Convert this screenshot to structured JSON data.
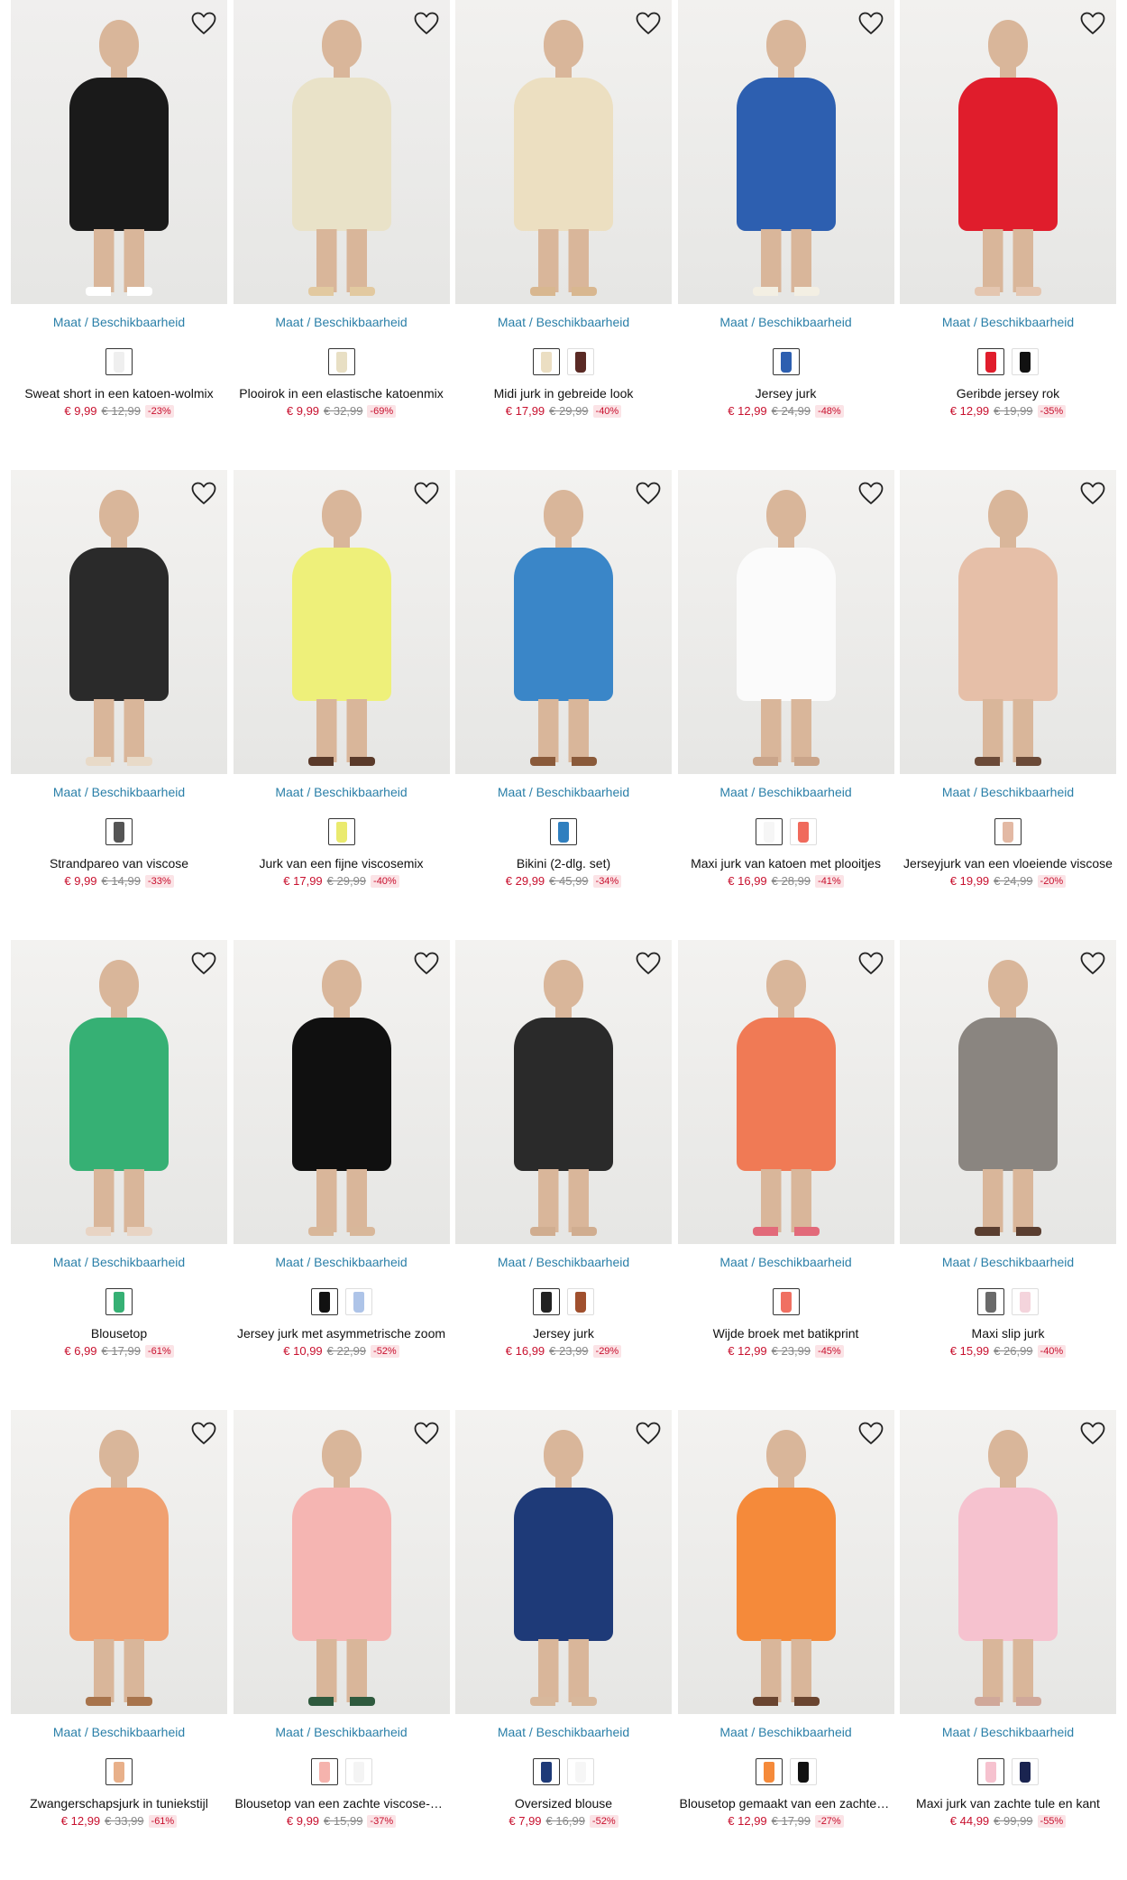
{
  "availability_label": "Maat / Beschikbaarheid",
  "products": [
    {
      "name": "Sweat short in een katoen-wolmix",
      "price": "€ 9,99",
      "old_price": "€ 12,99",
      "discount": "-23%",
      "image_colors": [
        "#f0efee",
        "#1a1a1a",
        "#ffffff"
      ],
      "swatches": [
        "#efefef"
      ]
    },
    {
      "name": "Plooirok in een elastische katoenmix",
      "price": "€ 9,99",
      "old_price": "€ 32,99",
      "discount": "-69%",
      "image_colors": [
        "#f0efee",
        "#e9e2c8",
        "#e2c9a0"
      ],
      "swatches": [
        "#e8dfc4"
      ]
    },
    {
      "name": "Midi jurk in gebreide look",
      "price": "€ 17,99",
      "old_price": "€ 29,99",
      "discount": "-40%",
      "image_colors": [
        "#f2f1ef",
        "#ecdfc1",
        "#d8b790"
      ],
      "swatches": [
        "#ebdec2",
        "#5a2a25"
      ]
    },
    {
      "name": "Jersey jurk",
      "price": "€ 12,99",
      "old_price": "€ 24,99",
      "discount": "-48%",
      "image_colors": [
        "#f2f1ef",
        "#2d5fb0",
        "#f3efe3"
      ],
      "swatches": [
        "#2d5fb0"
      ]
    },
    {
      "name": "Geribde jersey rok",
      "price": "€ 12,99",
      "old_price": "€ 19,99",
      "discount": "-35%",
      "image_colors": [
        "#f2f1ef",
        "#e01d2c",
        "#e4c6b0"
      ],
      "swatches": [
        "#e01d2c",
        "#111111"
      ]
    },
    {
      "name": "Strandpareo van viscose",
      "price": "€ 9,99",
      "old_price": "€ 14,99",
      "discount": "-33%",
      "image_colors": [
        "#f3f2f0",
        "#2a2a2a",
        "#e8dac8"
      ],
      "swatches": [
        "#555555"
      ]
    },
    {
      "name": "Jurk van een fijne viscosemix",
      "price": "€ 17,99",
      "old_price": "€ 29,99",
      "discount": "-40%",
      "image_colors": [
        "#f3f2f0",
        "#eef07a",
        "#5a3a2a"
      ],
      "swatches": [
        "#eaea6e"
      ]
    },
    {
      "name": "Bikini (2-dlg. set)",
      "price": "€ 29,99",
      "old_price": "€ 45,99",
      "discount": "-34%",
      "image_colors": [
        "#f3f2f0",
        "#3a86c8",
        "#8a5a3a"
      ],
      "swatches": [
        "#2f7fbf"
      ]
    },
    {
      "name": "Maxi jurk van katoen met plooitjes",
      "price": "€ 16,99",
      "old_price": "€ 28,99",
      "discount": "-41%",
      "image_colors": [
        "#f3f2f0",
        "#fbfbfb",
        "#caa58a"
      ],
      "swatches": [
        "#f6f6f6",
        "#f06a5c"
      ]
    },
    {
      "name": "Jerseyjurk van een vloeiende viscose",
      "price": "€ 19,99",
      "old_price": "€ 24,99",
      "discount": "-20%",
      "image_colors": [
        "#f3f2f0",
        "#e6bfa8",
        "#6b4a38"
      ],
      "swatches": [
        "#e3b9a4"
      ]
    },
    {
      "name": "Blousetop",
      "price": "€ 6,99",
      "old_price": "€ 17,99",
      "discount": "-61%",
      "image_colors": [
        "#f3f2f0",
        "#36b074",
        "#e8d4c4"
      ],
      "swatches": [
        "#36b074"
      ]
    },
    {
      "name": "Jersey jurk met asymmetrische zoom",
      "price": "€ 10,99",
      "old_price": "€ 22,99",
      "discount": "-52%",
      "image_colors": [
        "#f3f2f0",
        "#101010",
        "#d8b79a"
      ],
      "swatches": [
        "#111111",
        "#aec4e8"
      ]
    },
    {
      "name": "Jersey jurk",
      "price": "€ 16,99",
      "old_price": "€ 23,99",
      "discount": "-29%",
      "image_colors": [
        "#f3f2f0",
        "#2a2a2a",
        "#d0ad90"
      ],
      "swatches": [
        "#222222",
        "#a0502e"
      ]
    },
    {
      "name": "Wijde broek met batikprint",
      "price": "€ 12,99",
      "old_price": "€ 23,99",
      "discount": "-45%",
      "image_colors": [
        "#f3f2f0",
        "#f07a55",
        "#e26a7a"
      ],
      "swatches": [
        "#f07062"
      ]
    },
    {
      "name": "Maxi slip jurk",
      "price": "€ 15,99",
      "old_price": "€ 26,99",
      "discount": "-40%",
      "image_colors": [
        "#f3f2f0",
        "#8a8580",
        "#5a3e30"
      ],
      "swatches": [
        "#6a6a6a",
        "#f4d4dc"
      ]
    },
    {
      "name": "Zwangerschapsjurk in tuniekstijl",
      "price": "€ 12,99",
      "old_price": "€ 33,99",
      "discount": "-61%",
      "image_colors": [
        "#f3f2f0",
        "#f0a070",
        "#a8744c"
      ],
      "swatches": [
        "#e8b08a"
      ]
    },
    {
      "name": "Blousetop van een zachte viscose-mix",
      "price": "€ 9,99",
      "old_price": "€ 15,99",
      "discount": "-37%",
      "image_colors": [
        "#f3f2f0",
        "#f5b5b2",
        "#2f5a3e"
      ],
      "swatches": [
        "#f5b3ad",
        "#f4f4f4"
      ]
    },
    {
      "name": "Oversized blouse",
      "price": "€ 7,99",
      "old_price": "€ 16,99",
      "discount": "-52%",
      "image_colors": [
        "#f3f2f0",
        "#1e3a78",
        "#d8b89c"
      ],
      "swatches": [
        "#1e3a78",
        "#f6f6f6"
      ]
    },
    {
      "name": "Blousetop gemaakt van een zachte viscose",
      "price": "€ 12,99",
      "old_price": "€ 17,99",
      "discount": "-27%",
      "image_colors": [
        "#f3f2f0",
        "#f58a3a",
        "#6a4530"
      ],
      "swatches": [
        "#f58a3a",
        "#111111"
      ]
    },
    {
      "name": "Maxi jurk van zachte tule en kant",
      "price": "€ 44,99",
      "old_price": "€ 99,99",
      "discount": "-55%",
      "image_colors": [
        "#f3f2f0",
        "#f6c2cf",
        "#d0a89a"
      ],
      "swatches": [
        "#f6c2cf",
        "#1a2450"
      ]
    }
  ]
}
